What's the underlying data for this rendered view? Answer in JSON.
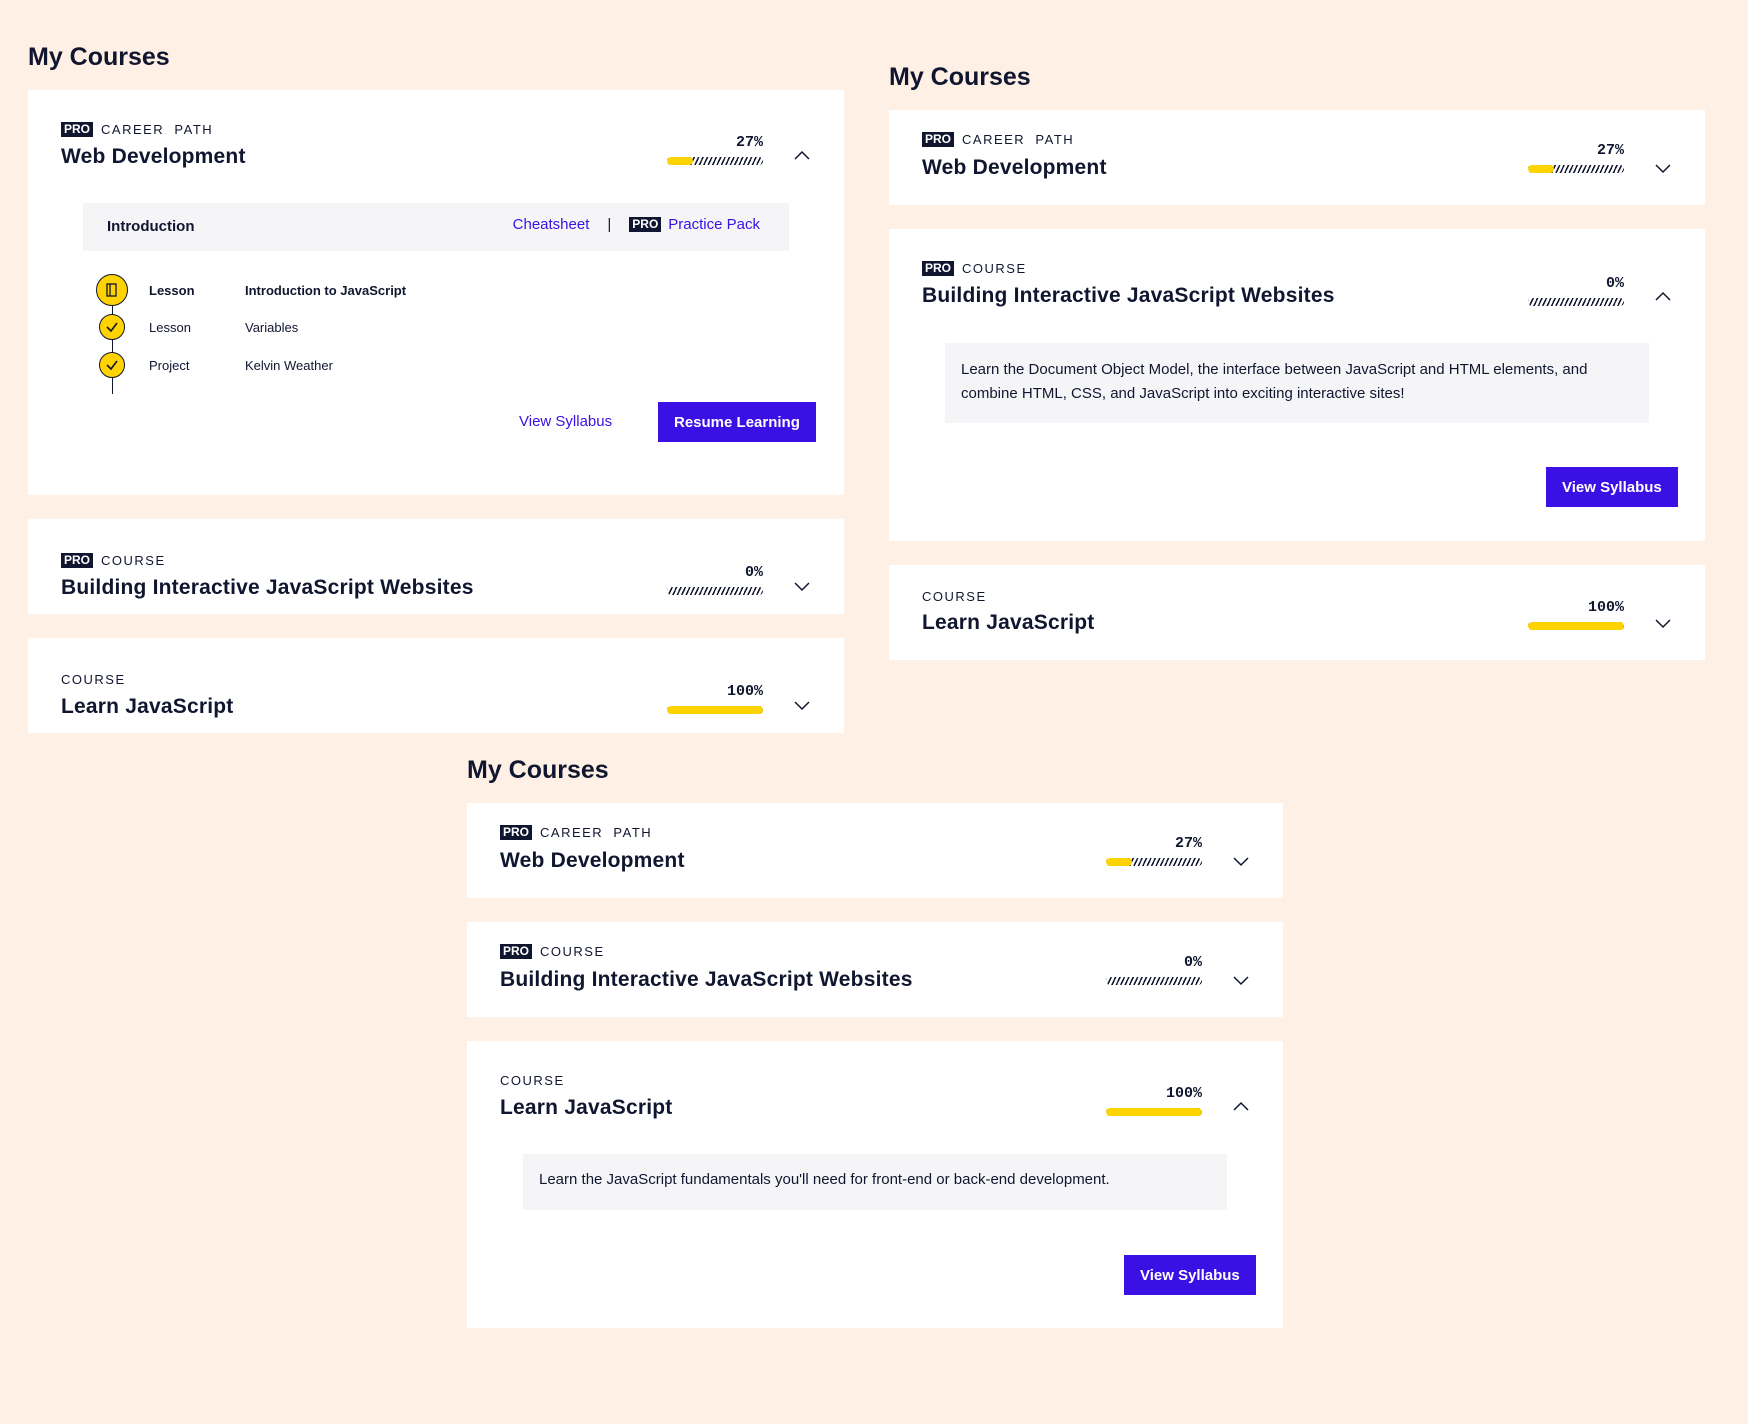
{
  "panel_a": {
    "title": "My Courses",
    "courses": [
      {
        "pro": "PRO",
        "kind": "CAREER  PATH",
        "name": "Web Development",
        "progress": "27%",
        "progress_fraction": 0.27
      },
      {
        "pro": "PRO",
        "kind": "COURSE",
        "name": "Building Interactive JavaScript Websites",
        "progress": "0%",
        "progress_fraction": 0
      },
      {
        "kind": "COURSE",
        "name": "Learn JavaScript",
        "progress": "100%",
        "progress_fraction": 1
      }
    ],
    "module": {
      "name": "Introduction",
      "cheatsheet": "Cheatsheet",
      "separator": "|",
      "pro": "PRO",
      "practice_pack": "Practice Pack",
      "items": [
        {
          "type": "Lesson",
          "name": "Introduction to JavaScript",
          "status": "current"
        },
        {
          "type": "Lesson",
          "name": "Variables",
          "status": "complete"
        },
        {
          "type": "Project",
          "name": "Kelvin Weather",
          "status": "complete"
        }
      ]
    },
    "view_syllabus": "View Syllabus",
    "resume_learning": "Resume Learning"
  },
  "panel_b": {
    "title": "My Courses",
    "courses": [
      {
        "pro": "PRO",
        "kind": "CAREER  PATH",
        "name": "Web Development",
        "progress": "27%",
        "progress_fraction": 0.27
      },
      {
        "pro": "PRO",
        "kind": "COURSE",
        "name": "Building Interactive JavaScript Websites",
        "progress": "0%",
        "progress_fraction": 0,
        "description": "Learn the Document Object Model, the interface between JavaScript and HTML elements, and combine HTML, CSS, and JavaScript into exciting interactive sites!"
      },
      {
        "kind": "COURSE",
        "name": "Learn JavaScript",
        "progress": "100%",
        "progress_fraction": 1
      }
    ],
    "view_syllabus": "View Syllabus"
  },
  "panel_c": {
    "title": "My Courses",
    "courses": [
      {
        "pro": "PRO",
        "kind": "CAREER  PATH",
        "name": "Web Development",
        "progress": "27%",
        "progress_fraction": 0.27
      },
      {
        "pro": "PRO",
        "kind": "COURSE",
        "name": "Building Interactive JavaScript Websites",
        "progress": "0%",
        "progress_fraction": 0
      },
      {
        "kind": "COURSE",
        "name": "Learn JavaScript",
        "progress": "100%",
        "progress_fraction": 1,
        "description": "Learn the JavaScript fundamentals you'll need for front-end or back-end development."
      }
    ],
    "view_syllabus": "View Syllabus"
  },
  "colors": {
    "background": "#fff0e5",
    "accent": "#3a10e5",
    "progress": "#ffd300",
    "ink": "#10162f"
  },
  "icons": {
    "chevron_up": "chevron-up-icon",
    "chevron_down": "chevron-down-icon",
    "check": "check-icon",
    "book": "book-icon"
  }
}
